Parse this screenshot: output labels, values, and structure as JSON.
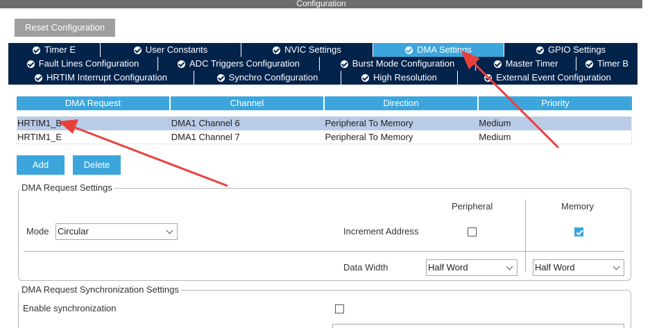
{
  "window": {
    "title": "Configuration"
  },
  "toolbar": {
    "reset_label": "Reset Configuration"
  },
  "tabs": {
    "row1": [
      {
        "label": "Timer E",
        "active": false
      },
      {
        "label": "User Constants",
        "active": false
      },
      {
        "label": "NVIC Settings",
        "active": false
      },
      {
        "label": "DMA Settings",
        "active": true
      },
      {
        "label": "GPIO Settings",
        "active": false
      }
    ],
    "row2": [
      {
        "label": "Fault Lines Configuration",
        "active": false
      },
      {
        "label": "ADC Triggers Configuration",
        "active": false
      },
      {
        "label": "Burst Mode Configuration",
        "active": false
      },
      {
        "label": "Master Timer",
        "active": false
      },
      {
        "label": "Timer B",
        "active": false
      }
    ],
    "row3": [
      {
        "label": "HRTIM Interrupt Configuration",
        "active": false
      },
      {
        "label": "Synchro Configuration",
        "active": false
      },
      {
        "label": "High Resolution",
        "active": false
      },
      {
        "label": "External Event Configuration",
        "active": false
      }
    ]
  },
  "dma_table": {
    "headers": [
      "DMA Request",
      "Channel",
      "Direction",
      "Priority"
    ],
    "rows": [
      {
        "request": "HRTIM1_B",
        "channel": "DMA1 Channel 6",
        "direction": "Peripheral To Memory",
        "priority": "Medium",
        "selected": true
      },
      {
        "request": "HRTIM1_E",
        "channel": "DMA1 Channel 7",
        "direction": "Peripheral To Memory",
        "priority": "Medium",
        "selected": false
      }
    ]
  },
  "actions": {
    "add_label": "Add",
    "delete_label": "Delete"
  },
  "request_settings": {
    "legend": "DMA Request Settings",
    "peripheral_header": "Peripheral",
    "memory_header": "Memory",
    "mode_label": "Mode",
    "mode_value": "Circular",
    "increment_label": "Increment Address",
    "peripheral_increment": false,
    "memory_increment": true,
    "data_width_label": "Data Width",
    "peripheral_width": "Half Word",
    "memory_width": "Half Word"
  },
  "sync_settings": {
    "legend": "DMA Request Synchronization Settings",
    "enable_label": "Enable synchronization",
    "enabled": false
  },
  "colors": {
    "tab_bg": "#03234b",
    "tab_active": "#3ca6dc",
    "accent": "#3ca6dc",
    "selected_row": "#b9cbe6",
    "annotation_arrow": "#e8413c"
  }
}
